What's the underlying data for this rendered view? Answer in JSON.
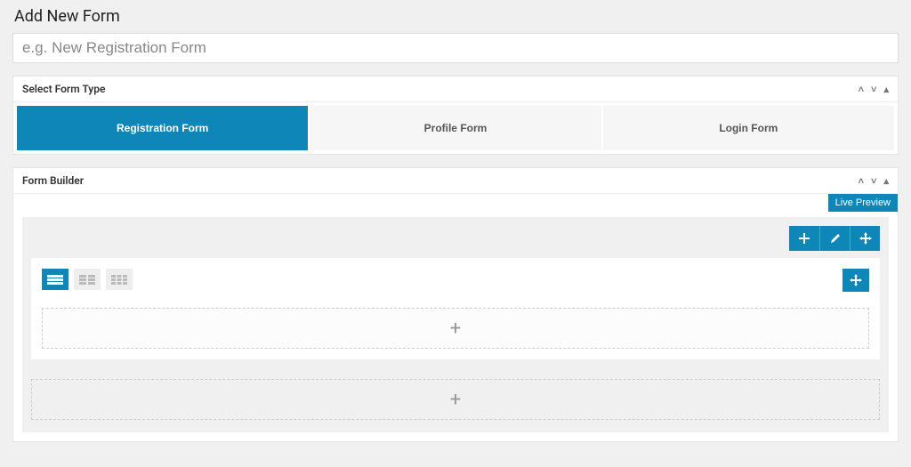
{
  "page": {
    "title": "Add New Form",
    "formNamePlaceholder": "e.g. New Registration Form"
  },
  "formTypePanel": {
    "header": "Select Form Type",
    "options": [
      {
        "label": "Registration Form",
        "active": true
      },
      {
        "label": "Profile Form",
        "active": false
      },
      {
        "label": "Login Form",
        "active": false
      }
    ]
  },
  "builderPanel": {
    "header": "Form Builder",
    "livePreviewLabel": "Live Preview",
    "toolbar": {
      "addIcon": "plus",
      "editIcon": "pencil",
      "moveIcon": "move"
    },
    "columnOptions": [
      {
        "cols": 1,
        "active": true
      },
      {
        "cols": 2,
        "active": false
      },
      {
        "cols": 3,
        "active": false
      }
    ],
    "dropzoneGlyph": "+",
    "outerDropzoneGlyph": "+"
  },
  "colors": {
    "accent": "#0e86b8"
  }
}
